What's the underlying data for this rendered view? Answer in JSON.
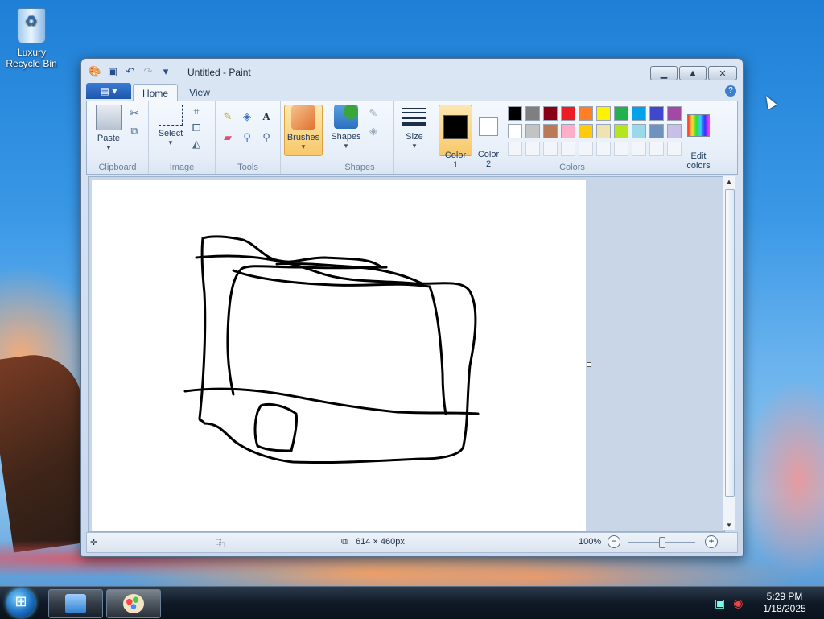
{
  "desktop": {
    "icon_label": "Luxury Recycle Bin"
  },
  "window": {
    "title": "Untitled - Paint"
  },
  "tabs": {
    "home": "Home",
    "view": "View"
  },
  "ribbon": {
    "clipboard": {
      "paste": "Paste",
      "group": "Clipboard"
    },
    "image": {
      "select": "Select",
      "group": "Image"
    },
    "tools": {
      "group": "Tools"
    },
    "brushes": "Brushes",
    "shapes": {
      "label": "Shapes",
      "group": "Shapes"
    },
    "size": "Size",
    "colors": {
      "color1": "Color\n1",
      "color2": "Color\n2",
      "edit": "Edit\ncolors",
      "group": "Colors",
      "palette_row1": [
        "#000000",
        "#7f7f7f",
        "#880015",
        "#ed1c24",
        "#ff7f27",
        "#fff200",
        "#22b14c",
        "#00a2e8",
        "#3f48cc",
        "#a349a4"
      ],
      "palette_row2": [
        "#ffffff",
        "#c3c3c3",
        "#b97a57",
        "#ffaec9",
        "#ffc90e",
        "#efe4b0",
        "#b5e61d",
        "#99d9ea",
        "#7092be",
        "#c8bfe7"
      ],
      "color1_value": "#000000",
      "color2_value": "#ffffff"
    }
  },
  "status": {
    "canvas_size": "614 × 460px",
    "zoom": "100%"
  },
  "taskbar": {
    "time": "5:29 PM",
    "date": "1/18/2025"
  }
}
